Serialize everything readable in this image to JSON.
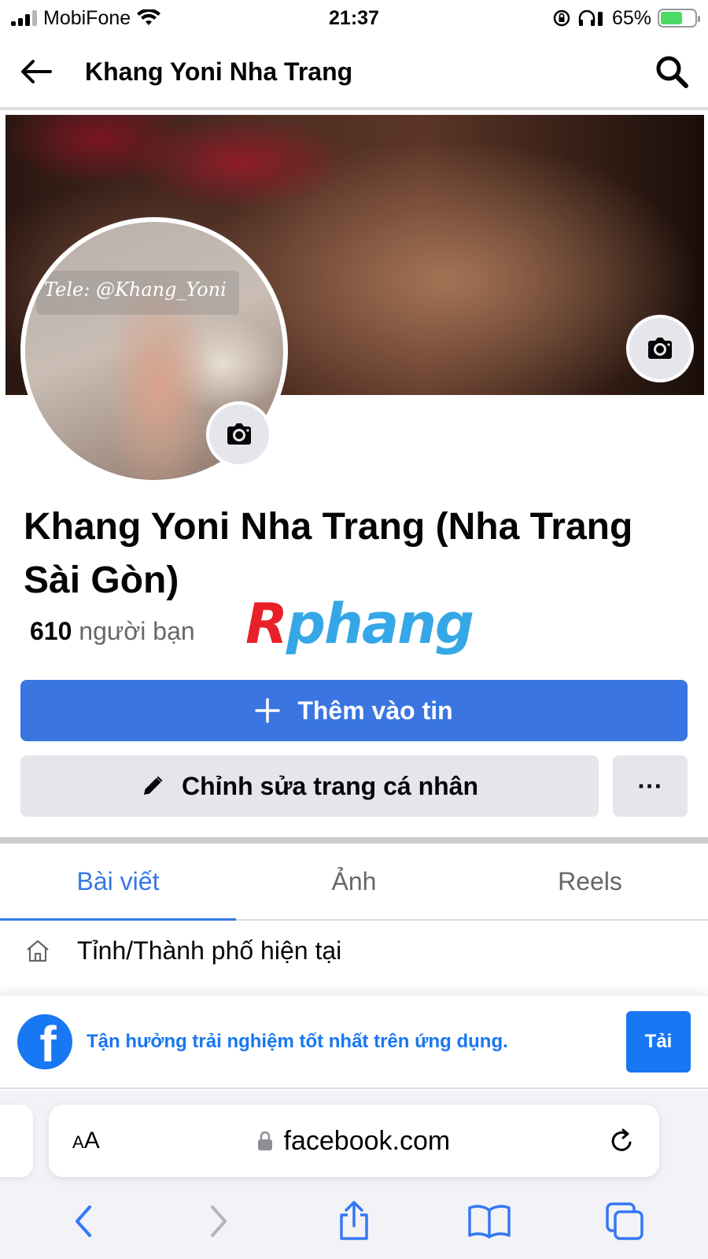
{
  "status_bar": {
    "carrier": "MobiFone",
    "time": "21:37",
    "battery_percent": "65%",
    "battery_level": 0.65
  },
  "header": {
    "title": "Khang Yoni Nha Trang"
  },
  "avatar": {
    "watermark_text": "Tele: @Khang_Yoni"
  },
  "profile": {
    "name": "Khang Yoni Nha Trang (Nha Trang Sài Gòn)",
    "friends_count": "610",
    "friends_label": "người bạn"
  },
  "overlay_logo": {
    "first_letter": "R",
    "rest": "phang"
  },
  "actions": {
    "add_story_label": "Thêm vào tin",
    "edit_profile_label": "Chỉnh sửa trang cá nhân",
    "more_label": "···"
  },
  "tabs": [
    {
      "label": "Bài viết",
      "active": true
    },
    {
      "label": "Ảnh",
      "active": false
    },
    {
      "label": "Reels",
      "active": false
    }
  ],
  "info": {
    "current_city": "Tỉnh/Thành phố hiện tại"
  },
  "app_banner": {
    "text": "Tận hưởng trải nghiệm tốt nhất trên ứng dụng.",
    "button_label": "Tải"
  },
  "browser": {
    "text_size_label": "AA",
    "url": "facebook.com"
  },
  "colors": {
    "primary_blue": "#3a75e1",
    "facebook_blue": "#1877f2",
    "tab_active": "#3578e5"
  },
  "icons": {
    "back": "arrow-left-icon",
    "search": "search-icon",
    "camera": "camera-icon",
    "plus": "plus-icon",
    "pencil": "pencil-icon",
    "home": "home-icon",
    "lock": "lock-icon",
    "reload": "reload-icon",
    "share": "share-icon",
    "bookmarks": "book-icon",
    "tabs": "tabs-icon"
  }
}
